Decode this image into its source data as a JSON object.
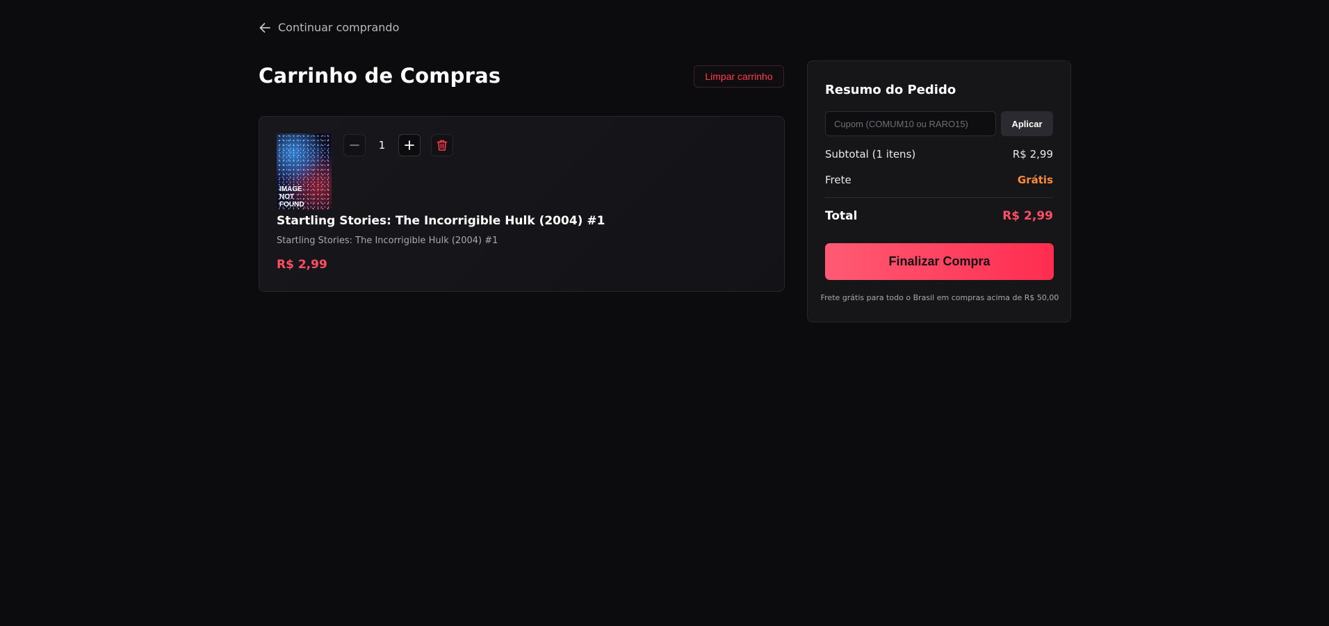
{
  "back_link": {
    "label": "Continuar comprando",
    "icon": "arrow-left-icon"
  },
  "cart": {
    "title": "Carrinho de Compras",
    "clear_label": "Limpar carrinho",
    "items": [
      {
        "cover_text": "IMAGE\nNOT\nFOUND",
        "quantity": "1",
        "title": "Startling Stories: The Incorrigible Hulk (2004) #1",
        "subtitle": "Startling Stories: The Incorrigible Hulk (2004) #1",
        "price": "R$ 2,99"
      }
    ]
  },
  "summary": {
    "title": "Resumo do Pedido",
    "coupon_placeholder": "Cupom (COMUM10 ou RARO15)",
    "coupon_value": "",
    "apply_label": "Aplicar",
    "subtotal_label": "Subtotal (1 itens)",
    "subtotal_value": "R$ 2,99",
    "shipping_label": "Frete",
    "shipping_value": "Grátis",
    "total_label": "Total",
    "total_value": "R$ 2,99",
    "checkout_label": "Finalizar Compra",
    "shipping_note": "Frete grátis para todo o Brasil em compras acima de R$ 50,00"
  },
  "colors": {
    "background": "#0c0c0f",
    "accent": "#ff4d63",
    "danger": "#ff3b4e",
    "shipping_free": "#ff8a3d"
  }
}
